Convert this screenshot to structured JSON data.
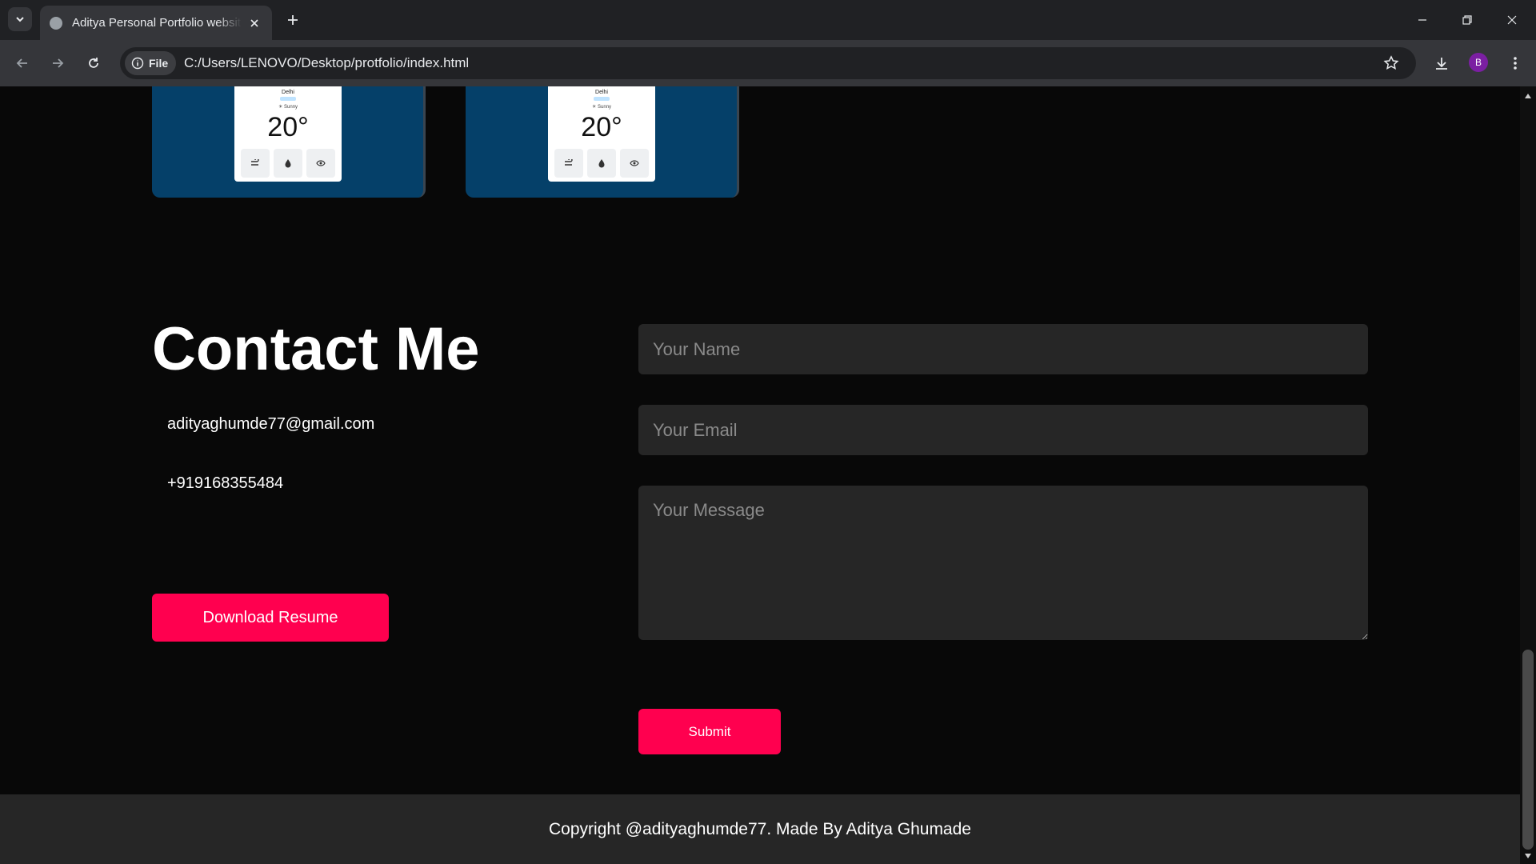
{
  "browser": {
    "tab_title": "Aditya Personal Portfolio website",
    "site_chip_label": "File",
    "url": "C:/Users/LENOVO/Desktop/protfolio/index.html",
    "profile_initial": "B"
  },
  "projects": [
    {
      "city": "Delhi",
      "condition": "☀ Sunny",
      "temperature": "20°"
    },
    {
      "city": "Delhi",
      "condition": "☀ Sunny",
      "temperature": "20°"
    }
  ],
  "contact": {
    "title": "Contact Me",
    "email": "adityaghumde77@gmail.com",
    "phone": "+919168355484",
    "resume_button": "Download Resume"
  },
  "form": {
    "name_placeholder": "Your Name",
    "email_placeholder": "Your Email",
    "message_placeholder": "Your Message",
    "submit_label": "Submit"
  },
  "footer": {
    "copyright": "Copyright @adityaghumde77. Made By Aditya Ghumade"
  },
  "colors": {
    "accent": "#ff004f",
    "background": "#080808",
    "field_bg": "#262626",
    "card_bg": "#054069"
  }
}
